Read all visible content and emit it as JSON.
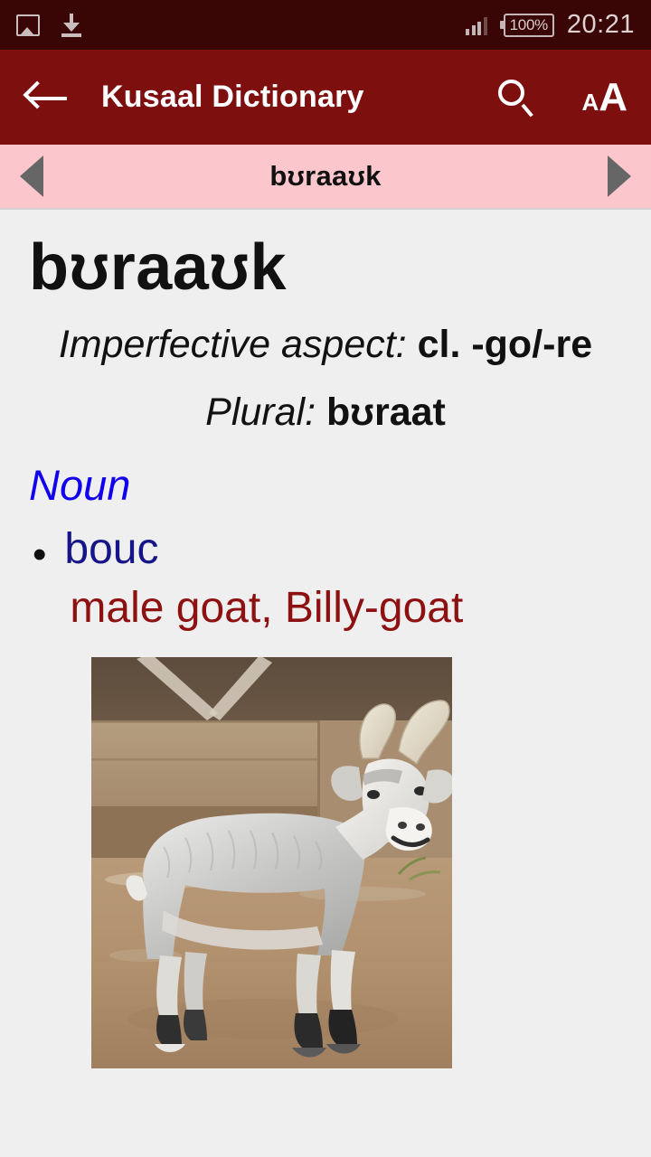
{
  "status_bar": {
    "icons": [
      "photo-icon",
      "download-icon",
      "signal-icon",
      "battery-icon"
    ],
    "battery": "100%",
    "time": "20:21",
    "background": "#3a0505"
  },
  "app_bar": {
    "back_label": "back-arrow",
    "title": "Kusaal Dictionary",
    "actions": [
      {
        "name": "search-icon",
        "label": "search"
      },
      {
        "name": "text-size-icon",
        "small": "A",
        "big": "A"
      }
    ],
    "background": "#7d0f0f"
  },
  "nav_strip": {
    "prev_label": "previous-entry",
    "word": "bʊraaʊk",
    "next_label": "next-entry",
    "background": "#fbc7cd"
  },
  "entry": {
    "headword": "bʊraaʊk",
    "inflections": [
      {
        "label": "Imperfective aspect:",
        "value": "cl. -go/-re"
      },
      {
        "label": "Plural:",
        "value": "bʊraat"
      }
    ],
    "part_of_speech": "Noun",
    "part_of_speech_color": "#1100ee",
    "senses": [
      {
        "bullet": "•",
        "gloss_fr": "bouc",
        "gloss_fr_color": "#151587",
        "gloss_en": "male goat, Billy-goat",
        "gloss_en_color": "#8d1111"
      }
    ],
    "image": {
      "name": "goat-photo",
      "alt": "grey and white billy-goat with curved horns standing on sandy ground in front of a wooden barn"
    },
    "background": "#efefef"
  }
}
